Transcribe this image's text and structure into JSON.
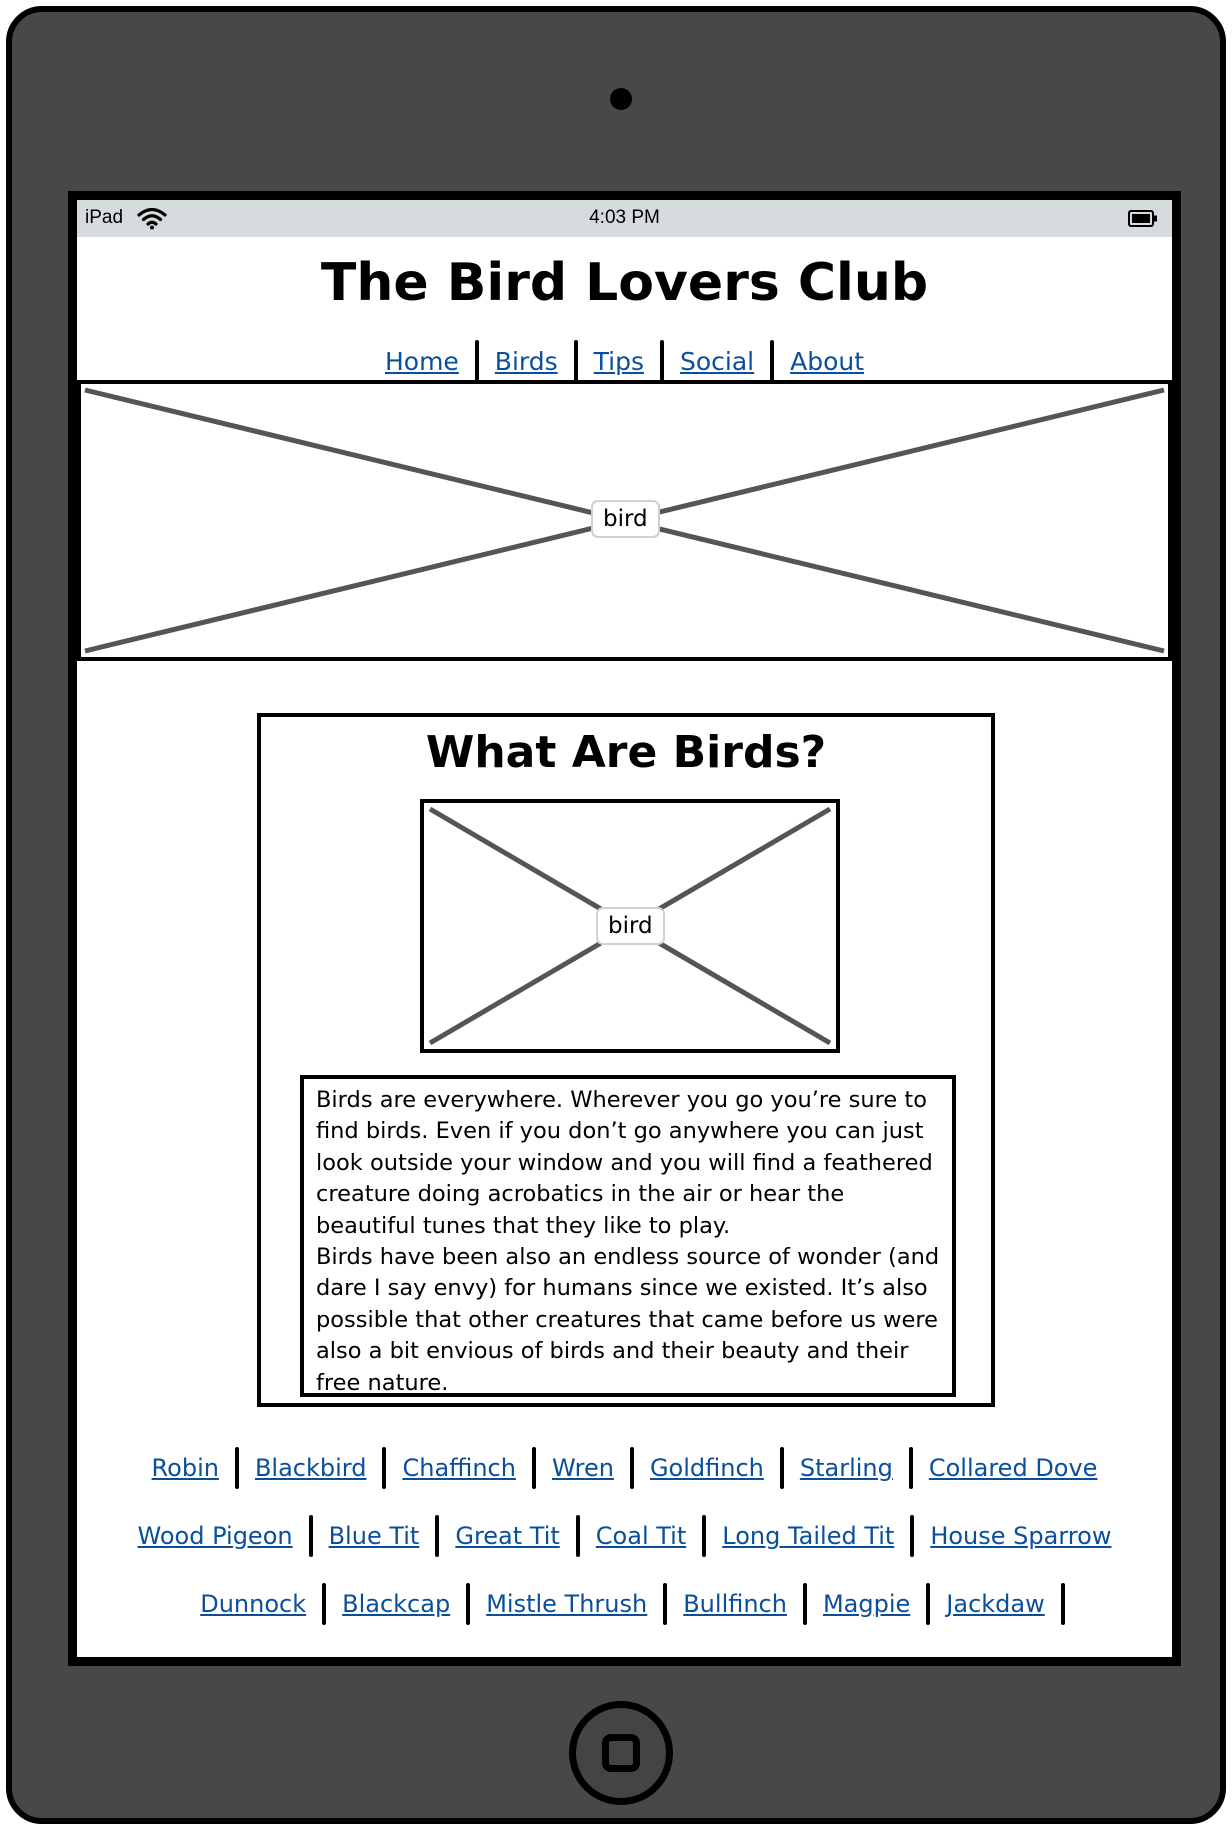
{
  "status_bar": {
    "device": "iPad",
    "time": "4:03 PM"
  },
  "header": {
    "title": "The Bird Lovers Club"
  },
  "nav": {
    "items": [
      {
        "label": "Home"
      },
      {
        "label": "Birds"
      },
      {
        "label": "Tips"
      },
      {
        "label": "Social"
      },
      {
        "label": "About"
      }
    ]
  },
  "hero": {
    "image_label": "bird"
  },
  "section": {
    "title": "What Are Birds?",
    "image_label": "bird",
    "body": "Birds are everywhere. Wherever you go you’re sure to find birds. Even if you don’t go anywhere you can just look outside your window and you will find a feathered creature doing acrobatics in the air or hear the beautiful tunes that they like to play.\nBirds have been also an endless source of wonder (and dare I say envy) for humans since we existed. It’s also possible that other creatures that came before us were also a bit envious of birds and their beauty and their free nature."
  },
  "bird_links": {
    "row1": [
      {
        "label": "Robin"
      },
      {
        "label": "Blackbird"
      },
      {
        "label": "Chaffinch"
      },
      {
        "label": "Wren"
      },
      {
        "label": "Goldfinch"
      },
      {
        "label": "Starling"
      },
      {
        "label": "Collared Dove"
      }
    ],
    "row2": [
      {
        "label": "Wood Pigeon"
      },
      {
        "label": "Blue Tit"
      },
      {
        "label": "Great Tit"
      },
      {
        "label": "Coal Tit"
      },
      {
        "label": "Long Tailed Tit"
      },
      {
        "label": "House Sparrow"
      }
    ],
    "row3": [
      {
        "label": "Dunnock"
      },
      {
        "label": "Blackcap"
      },
      {
        "label": "Mistle Thrush"
      },
      {
        "label": "Bullfinch"
      },
      {
        "label": "Magpie"
      },
      {
        "label": "Jackdaw"
      }
    ]
  },
  "colors": {
    "link": "#0a4f9c",
    "device_body": "#484848",
    "status_bar": "#d6dbde"
  }
}
